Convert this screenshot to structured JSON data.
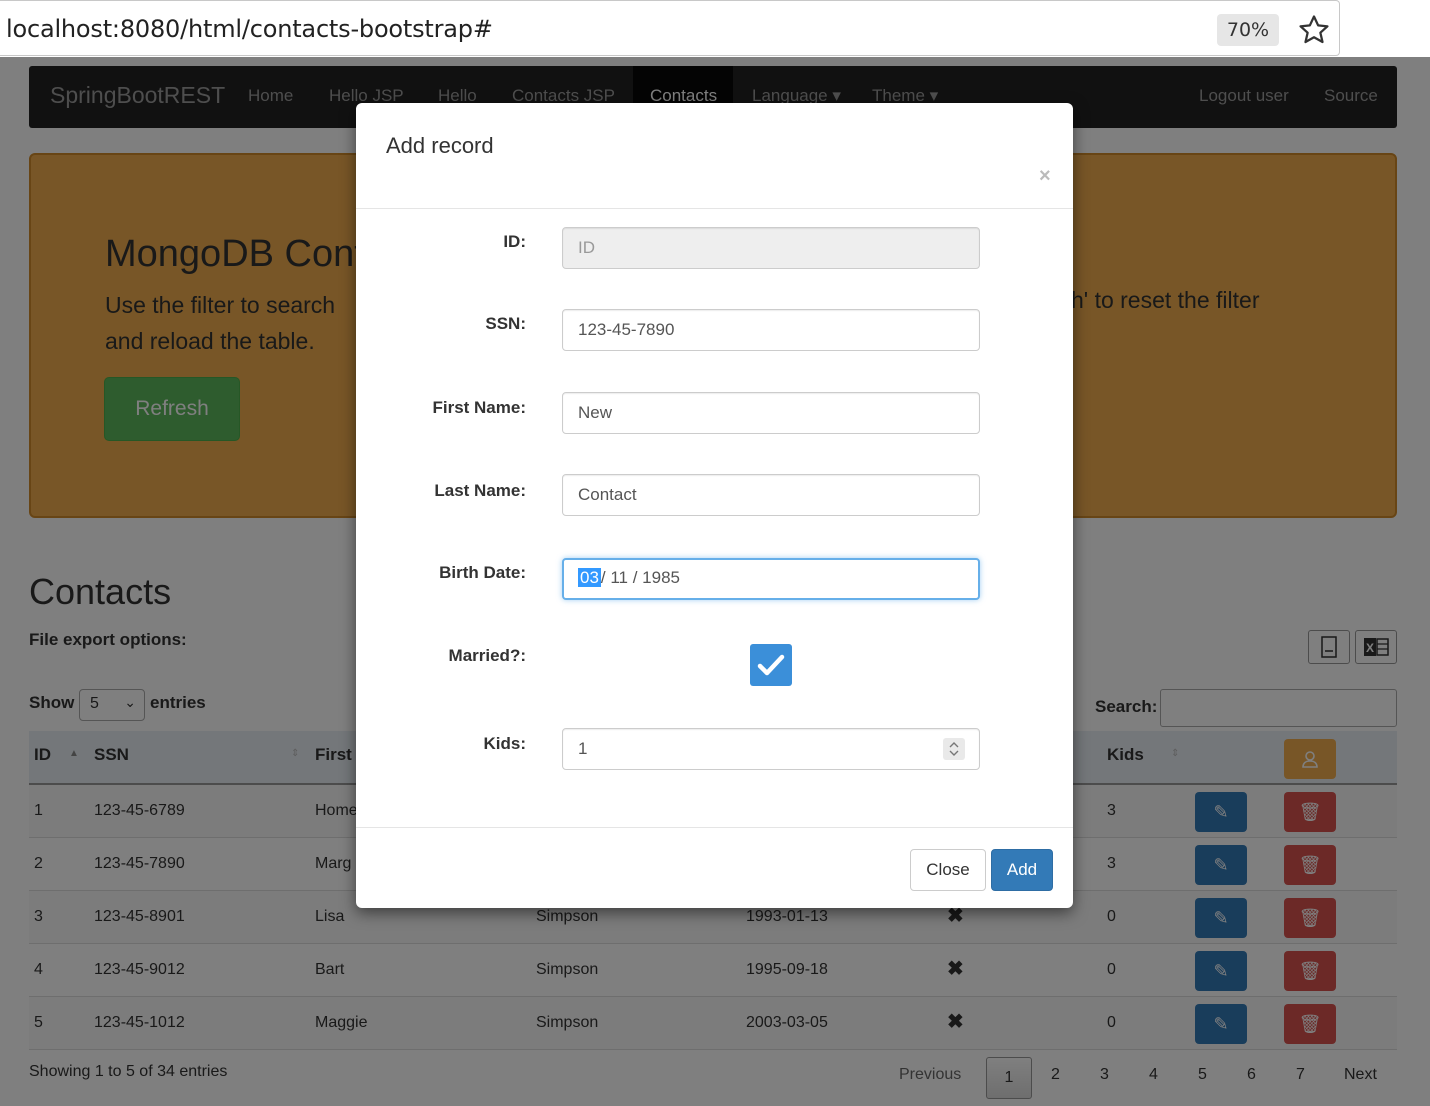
{
  "browser": {
    "url": "localhost:8080/html/contacts-bootstrap#",
    "zoom": "70%"
  },
  "navbar": {
    "brand": "SpringBootREST",
    "items": [
      "Home",
      "Hello JSP",
      "Hello",
      "Contacts JSP",
      "Contacts",
      "Language",
      "Theme"
    ],
    "right": [
      "Logout user",
      "Source"
    ]
  },
  "jumbotron": {
    "title": "MongoDB Conta",
    "line1": "Use the filter to search",
    "line1_right": "h' to reset the filter",
    "line2": "and reload the table.",
    "refresh_label": "Refresh"
  },
  "contacts": {
    "title": "Contacts",
    "export_label": "File export options:",
    "show_label": "Show",
    "show_value": "5",
    "entries_label": "entries",
    "search_label": "Search:",
    "headers": [
      "ID",
      "SSN",
      "First",
      "Kids"
    ],
    "rows": [
      {
        "id": "1",
        "ssn": "123-45-6789",
        "first": "Home",
        "last": "",
        "birth": "",
        "married": "",
        "kids": "3"
      },
      {
        "id": "2",
        "ssn": "123-45-7890",
        "first": "Marg",
        "last": "",
        "birth": "",
        "married": "",
        "kids": "3"
      },
      {
        "id": "3",
        "ssn": "123-45-8901",
        "first": "Lisa",
        "last": "Simpson",
        "birth": "1993-01-13",
        "married": "✖",
        "kids": "0"
      },
      {
        "id": "4",
        "ssn": "123-45-9012",
        "first": "Bart",
        "last": "Simpson",
        "birth": "1995-09-18",
        "married": "✖",
        "kids": "0"
      },
      {
        "id": "5",
        "ssn": "123-45-1012",
        "first": "Maggie",
        "last": "Simpson",
        "birth": "2003-03-05",
        "married": "✖",
        "kids": "0"
      }
    ],
    "footer_info": "Showing 1 to 5 of 34 entries",
    "pager": {
      "previous": "Previous",
      "pages": [
        "1",
        "2",
        "3",
        "4",
        "5",
        "6",
        "7"
      ],
      "next": "Next"
    }
  },
  "modal": {
    "title": "Add record",
    "close_x": "×",
    "fields": {
      "id_label": "ID:",
      "id_placeholder": "ID",
      "ssn_label": "SSN:",
      "ssn_value": "123-45-7890",
      "first_label": "First Name:",
      "first_value": "New",
      "last_label": "Last Name:",
      "last_value": "Contact",
      "birth_label": "Birth Date:",
      "birth_month": "03",
      "birth_rest": "/ 11 / 1985",
      "married_label": "Married?:",
      "married_checked": true,
      "kids_label": "Kids:",
      "kids_value": "1"
    },
    "close_button": "Close",
    "add_button": "Add"
  },
  "colors": {
    "navbar": "#222222",
    "jumbotron": "#f0ad4e",
    "refresh": "#5cb85c",
    "primary": "#337ab7",
    "danger": "#d9534f",
    "warning": "#f0ad4e"
  }
}
